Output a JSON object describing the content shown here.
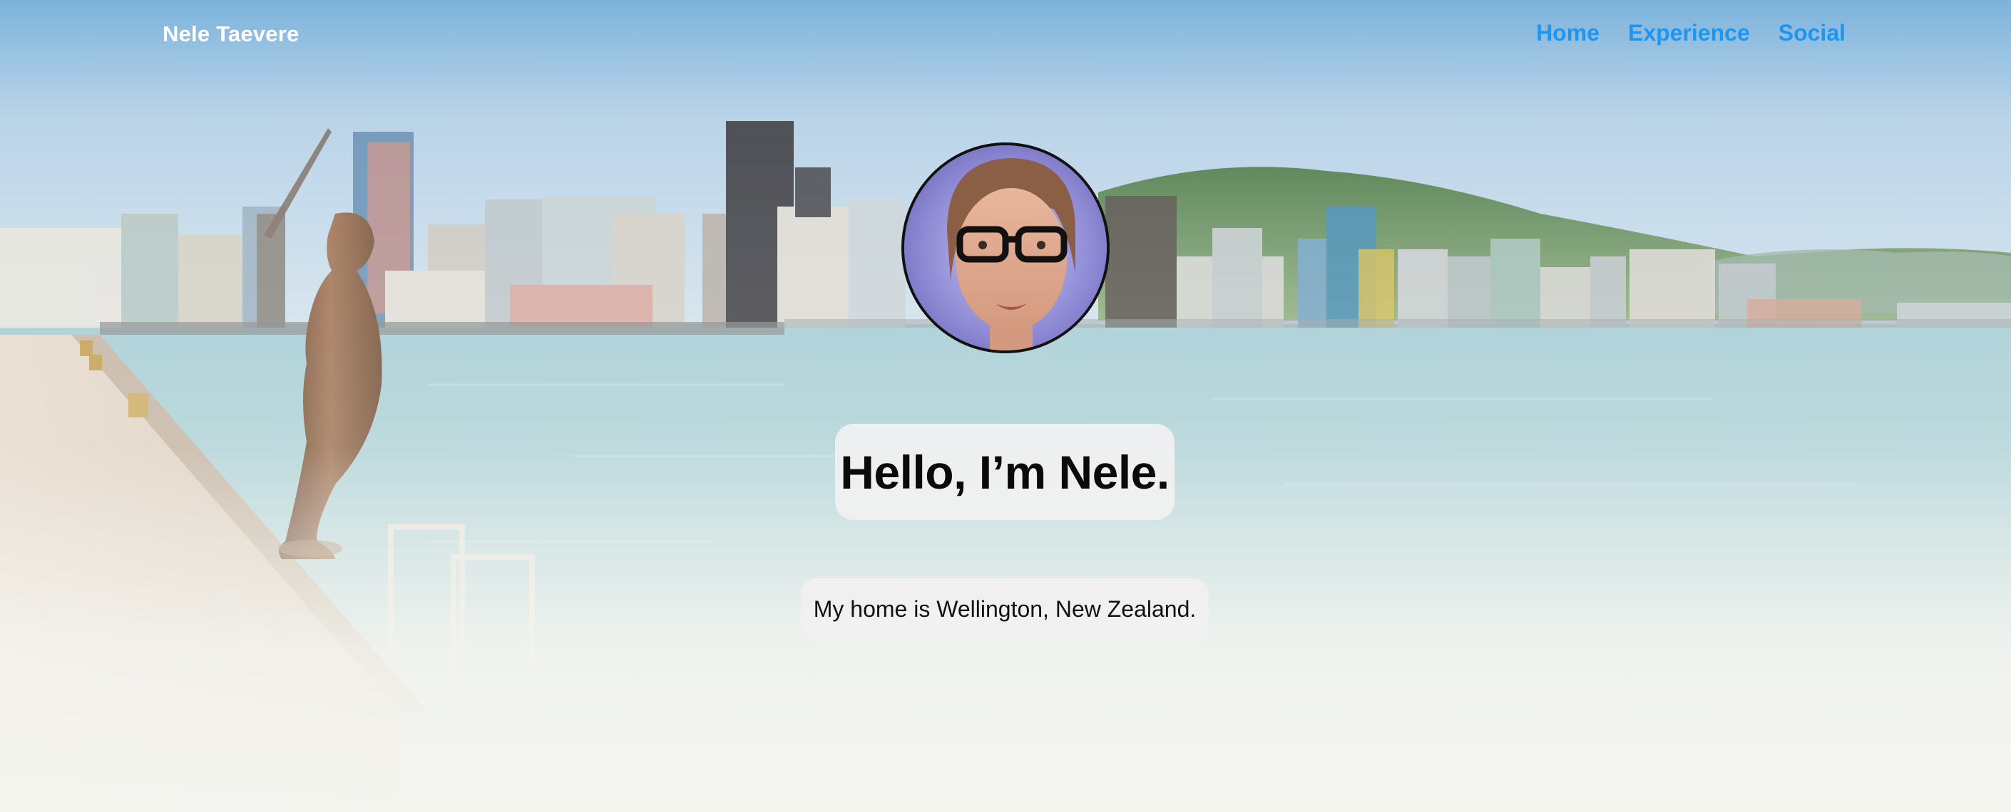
{
  "navbar": {
    "brand": "Nele Taevere",
    "links": [
      {
        "label": "Home"
      },
      {
        "label": "Experience"
      },
      {
        "label": "Social"
      }
    ]
  },
  "hero": {
    "headline": "Hello, I’m Nele.",
    "subtitle": "My home is Wellington, New Zealand."
  },
  "colors": {
    "nav_link": "#1e96f0",
    "brand": "#ffffff",
    "page_background": "#f5f5f0",
    "card_background": "#f0f0f0"
  },
  "icons": {
    "avatar": "profile-photo"
  }
}
